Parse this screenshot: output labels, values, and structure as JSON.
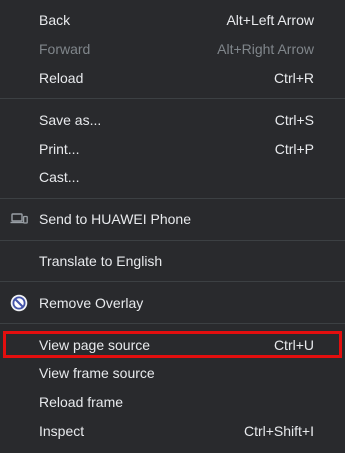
{
  "colors": {
    "background": "#292a2d",
    "text": "#e8eaed",
    "disabled_text": "#80868b",
    "separator": "#3c4043",
    "highlight_border": "#e30e0e"
  },
  "menu": {
    "nav": {
      "back": {
        "label": "Back",
        "shortcut": "Alt+Left Arrow"
      },
      "forward": {
        "label": "Forward",
        "shortcut": "Alt+Right Arrow",
        "disabled": true
      },
      "reload": {
        "label": "Reload",
        "shortcut": "Ctrl+R"
      }
    },
    "file": {
      "save_as": {
        "label": "Save as...",
        "shortcut": "Ctrl+S"
      },
      "print": {
        "label": "Print...",
        "shortcut": "Ctrl+P"
      },
      "cast": {
        "label": "Cast..."
      }
    },
    "send": {
      "label": "Send to HUAWEI Phone",
      "icon": "devices-icon"
    },
    "translate": {
      "label": "Translate to English"
    },
    "extension": {
      "label": "Remove Overlay",
      "icon": "no-entry-icon"
    },
    "developer": {
      "view_source": {
        "label": "View page source",
        "shortcut": "Ctrl+U",
        "highlighted": true
      },
      "view_frame_source": {
        "label": "View frame source"
      },
      "reload_frame": {
        "label": "Reload frame"
      },
      "inspect": {
        "label": "Inspect",
        "shortcut": "Ctrl+Shift+I"
      }
    }
  }
}
